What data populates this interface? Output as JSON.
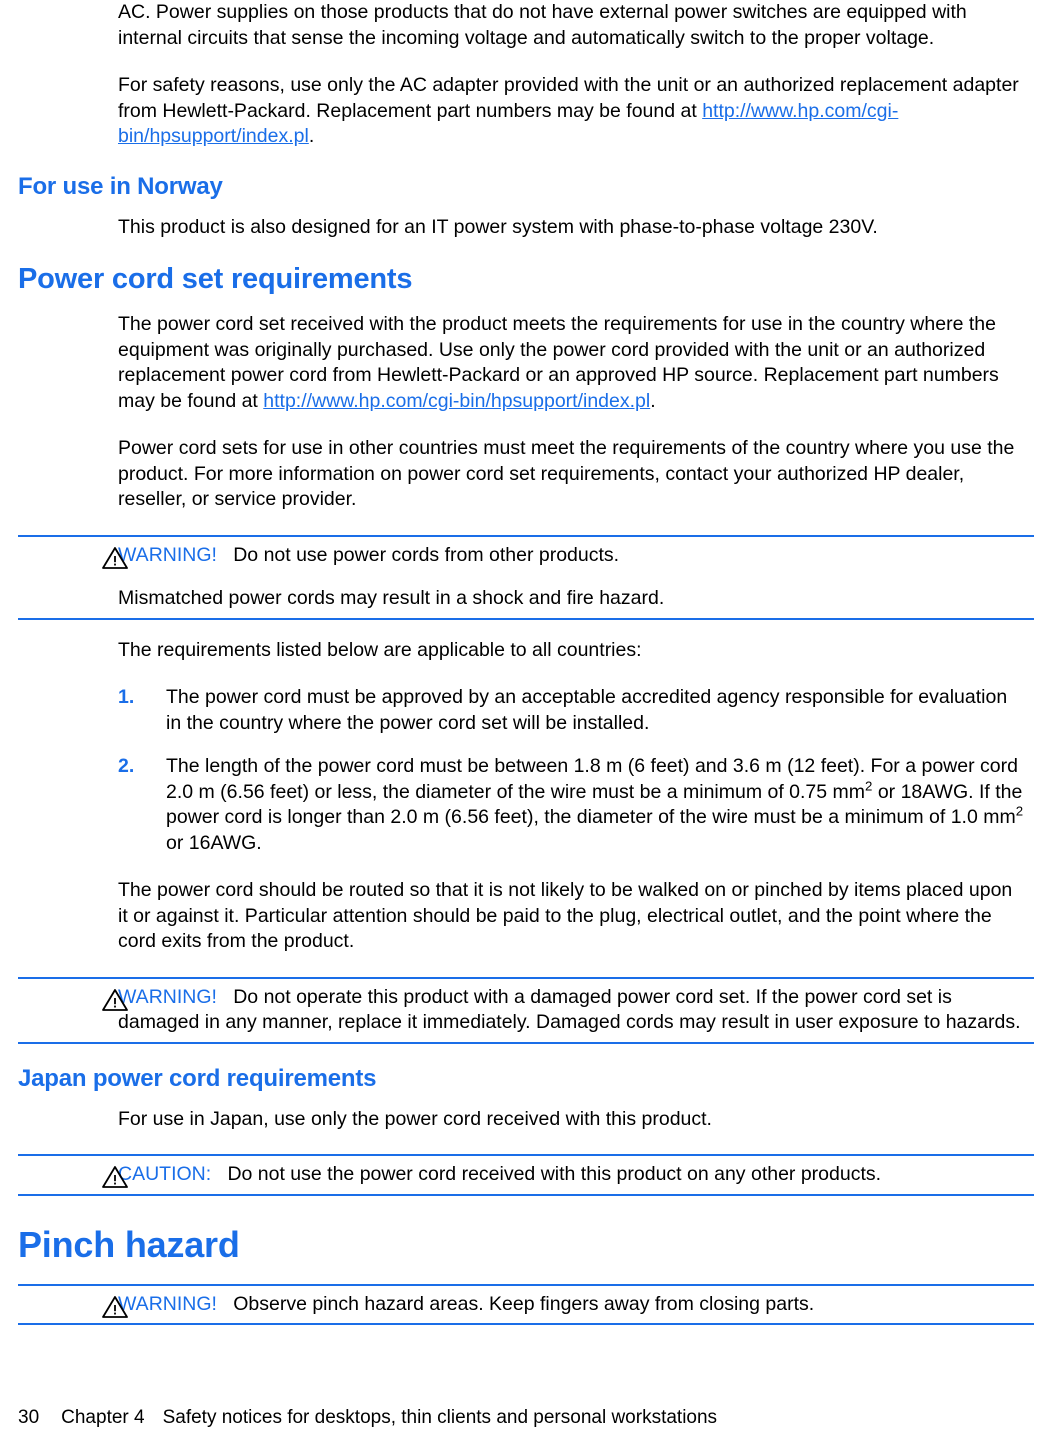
{
  "document": {
    "link_color": "#1a6ee8",
    "heading_color": "#1a6ee8",
    "rule_color": "#1a6ee8",
    "body_color": "#000000"
  },
  "intro": {
    "para_ac": "AC. Power supplies on those products that do not have external power switches are equipped with internal circuits that sense the incoming voltage and automatically switch to the proper voltage.",
    "para_safety_before_link": "For safety reasons, use only the AC adapter provided with the unit or an authorized replacement adapter from Hewlett-Packard. Replacement part numbers may be found at ",
    "para_safety_link": "http://www.hp.com/cgi-bin/hpsupport/index.pl",
    "para_safety_after_link": "."
  },
  "norway": {
    "heading": "For use in Norway",
    "para": "This product is also designed for an IT power system with phase-to-phase voltage 230V."
  },
  "power_cord": {
    "heading": "Power cord set requirements",
    "para1_before_link": "The power cord set received with the product meets the requirements for use in the country where the equipment was originally purchased. Use only the power cord provided with the unit or an authorized replacement power cord from Hewlett-Packard or an approved HP source. Replacement part numbers may be found at ",
    "para1_link": "http://www.hp.com/cgi-bin/hpsupport/index.pl",
    "para1_after_link": ".",
    "para2": "Power cord sets for use in other countries must meet the requirements of the country where you use the product. For more information on power cord set requirements, contact your authorized HP dealer, reseller, or service provider.",
    "warning1": {
      "icon": "warning-triangle-icon",
      "label": "WARNING!",
      "text": "Do not use power cords from other products.",
      "second_para": "Mismatched power cords may result in a shock and fire hazard."
    },
    "para3": "The requirements listed below are applicable to all countries:",
    "list": [
      {
        "number": "1.",
        "text": "The power cord must be approved by an acceptable accredited agency responsible for evaluation in the country where the power cord set will be installed."
      },
      {
        "number": "2.",
        "text_part1": "The length of the power cord must be between 1.8 m (6 feet) and 3.6 m (12 feet). For a power cord 2.0 m (6.56 feet) or less, the diameter of the wire must be a minimum of 0.75 mm",
        "sup1": "2",
        "text_part2": " or 18AWG. If the power cord is longer than 2.0 m (6.56 feet), the diameter of the wire must be a minimum of 1.0 mm",
        "sup2": "2",
        "text_part3": " or 16AWG."
      }
    ],
    "para4": "The power cord should be routed so that it is not likely to be walked on or pinched by items placed upon it or against it. Particular attention should be paid to the plug, electrical outlet, and the point where the cord exits from the product.",
    "warning2": {
      "icon": "warning-triangle-icon",
      "label": "WARNING!",
      "text": "Do not operate this product with a damaged power cord set. If the power cord set is damaged in any manner, replace it immediately. Damaged cords may result in user exposure to hazards."
    }
  },
  "japan": {
    "heading": "Japan power cord requirements",
    "para": "For use in Japan, use only the power cord received with this product.",
    "caution": {
      "icon": "caution-triangle-icon",
      "label": "CAUTION:",
      "text": "Do not use the power cord received with this product on any other products."
    }
  },
  "pinch": {
    "heading": "Pinch hazard",
    "warning": {
      "icon": "warning-triangle-icon",
      "label": "WARNING!",
      "text": "Observe pinch hazard areas. Keep fingers away from closing parts."
    }
  },
  "footer": {
    "page_number": "30",
    "chapter": "Chapter 4",
    "title": "Safety notices for desktops, thin clients and personal workstations"
  }
}
